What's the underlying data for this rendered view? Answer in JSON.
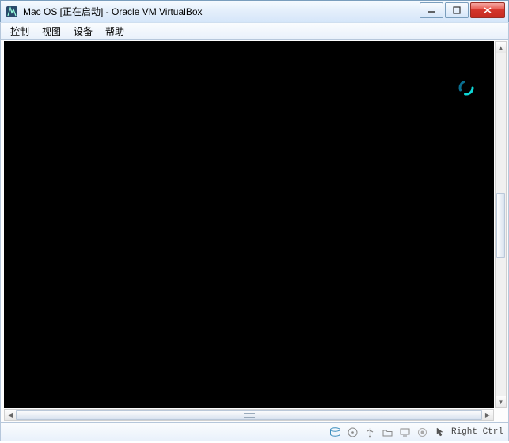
{
  "title": "Mac OS [正在启动] - Oracle VM VirtualBox",
  "menu": {
    "control": "控制",
    "view": "视图",
    "devices": "设备",
    "help": "帮助"
  },
  "status": {
    "hostkey": "Right Ctrl"
  }
}
